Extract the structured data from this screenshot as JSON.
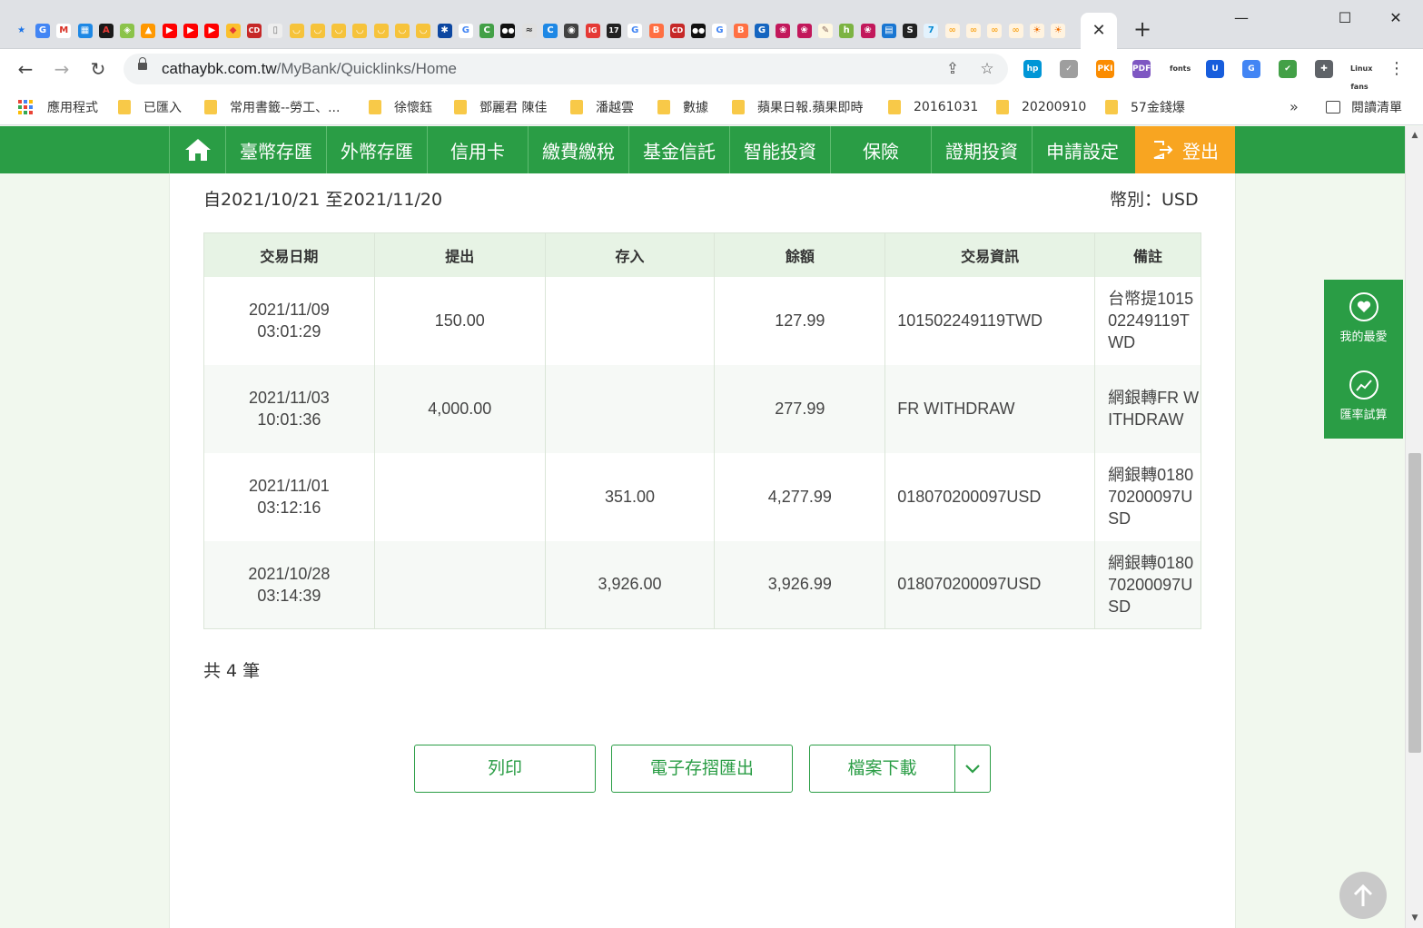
{
  "browser": {
    "favicons": [
      {
        "name": "bookmark-star-icon",
        "glyph": "★",
        "bg": "transparent",
        "fg": "#1a73e8"
      },
      {
        "name": "translate-icon",
        "glyph": "G",
        "bg": "#4285f4",
        "fg": "#fff"
      },
      {
        "name": "gmail-icon",
        "glyph": "M",
        "bg": "#fff",
        "fg": "#d93025"
      },
      {
        "name": "grid-app-icon",
        "glyph": "▦",
        "bg": "#1e88e5",
        "fg": "#fff"
      },
      {
        "name": "adobe-icon",
        "glyph": "A",
        "bg": "#1a1a1a",
        "fg": "#e53935"
      },
      {
        "name": "green-app-icon",
        "glyph": "◈",
        "bg": "#8bc34a",
        "fg": "#fff"
      },
      {
        "name": "orange-app-icon",
        "glyph": "▲",
        "bg": "#ff9800",
        "fg": "#fff"
      },
      {
        "name": "youtube-icon",
        "glyph": "▶",
        "bg": "#ff0000",
        "fg": "#fff"
      },
      {
        "name": "youtube-icon",
        "glyph": "▶",
        "bg": "#ff0000",
        "fg": "#fff"
      },
      {
        "name": "youtube-icon",
        "glyph": "▶",
        "bg": "#ff0000",
        "fg": "#fff"
      },
      {
        "name": "colorful-app-icon",
        "glyph": "◆",
        "bg": "#fbc02d",
        "fg": "#e53935"
      },
      {
        "name": "cd-icon",
        "glyph": "CD",
        "bg": "#c62828",
        "fg": "#fff"
      },
      {
        "name": "document-icon",
        "glyph": "▯",
        "bg": "#eee",
        "fg": "#777"
      },
      {
        "name": "yellow-site-icon",
        "glyph": "◡",
        "bg": "#f6c33b",
        "fg": "#fff"
      },
      {
        "name": "yellow-site-icon",
        "glyph": "◡",
        "bg": "#f6c33b",
        "fg": "#fff"
      },
      {
        "name": "yellow-site-icon",
        "glyph": "◡",
        "bg": "#f6c33b",
        "fg": "#fff"
      },
      {
        "name": "yellow-site-icon",
        "glyph": "◡",
        "bg": "#f6c33b",
        "fg": "#fff"
      },
      {
        "name": "yellow-site-icon",
        "glyph": "◡",
        "bg": "#f6c33b",
        "fg": "#fff"
      },
      {
        "name": "yellow-site-icon",
        "glyph": "◡",
        "bg": "#f6c33b",
        "fg": "#fff"
      },
      {
        "name": "yellow-site-icon",
        "glyph": "◡",
        "bg": "#f6c33b",
        "fg": "#fff"
      },
      {
        "name": "star-badge-icon",
        "glyph": "✱",
        "bg": "#0d47a1",
        "fg": "#fff"
      },
      {
        "name": "google-icon",
        "glyph": "G",
        "bg": "#fff",
        "fg": "#4285f4"
      },
      {
        "name": "c-app-icon",
        "glyph": "C",
        "bg": "#43a047",
        "fg": "#fff"
      },
      {
        "name": "medium-icon",
        "glyph": "●●",
        "bg": "#111",
        "fg": "#fff"
      },
      {
        "name": "ame-icon",
        "glyph": "≈",
        "bg": "#e0e0e0",
        "fg": "#333"
      },
      {
        "name": "c-app-icon",
        "glyph": "C",
        "bg": "#1e88e5",
        "fg": "#fff"
      },
      {
        "name": "globe-icon",
        "glyph": "◉",
        "bg": "#424242",
        "fg": "#fff"
      },
      {
        "name": "ig-icon",
        "glyph": "IG",
        "bg": "#e53935",
        "fg": "#fff"
      },
      {
        "name": "seventeen-icon",
        "glyph": "17",
        "bg": "#212121",
        "fg": "#fff"
      },
      {
        "name": "google-icon",
        "glyph": "G",
        "bg": "#fff",
        "fg": "#4285f4"
      },
      {
        "name": "blogger-icon",
        "glyph": "B",
        "bg": "#ff7043",
        "fg": "#fff"
      },
      {
        "name": "cd-icon",
        "glyph": "CD",
        "bg": "#c62828",
        "fg": "#fff"
      },
      {
        "name": "medium-icon",
        "glyph": "●●",
        "bg": "#111",
        "fg": "#fff"
      },
      {
        "name": "google-icon",
        "glyph": "G",
        "bg": "#fff",
        "fg": "#4285f4"
      },
      {
        "name": "blogger-icon",
        "glyph": "B",
        "bg": "#ff7043",
        "fg": "#fff"
      },
      {
        "name": "g-suite-icon",
        "glyph": "G",
        "bg": "#1565c0",
        "fg": "#fff"
      },
      {
        "name": "raspberry-icon",
        "glyph": "❀",
        "bg": "#c2185b",
        "fg": "#fff"
      },
      {
        "name": "raspberry-icon",
        "glyph": "❀",
        "bg": "#c2185b",
        "fg": "#fff"
      },
      {
        "name": "note-icon",
        "glyph": "✎",
        "bg": "#fff8e1",
        "fg": "#8d6e63"
      },
      {
        "name": "h-app-icon",
        "glyph": "h",
        "bg": "#7cb342",
        "fg": "#fff"
      },
      {
        "name": "raspberry-icon",
        "glyph": "❀",
        "bg": "#c2185b",
        "fg": "#fff"
      },
      {
        "name": "window-icon",
        "glyph": "▤",
        "bg": "#1976d2",
        "fg": "#fff"
      },
      {
        "name": "s-app-icon",
        "glyph": "S",
        "bg": "#222",
        "fg": "#fff"
      },
      {
        "name": "seven-icon",
        "glyph": "7",
        "bg": "#e3f2fd",
        "fg": "#0288d1"
      },
      {
        "name": "loop-icon",
        "glyph": "∞",
        "bg": "#fff3e0",
        "fg": "#f9a825"
      },
      {
        "name": "loop-icon",
        "glyph": "∞",
        "bg": "#fff3e0",
        "fg": "#f9a825"
      },
      {
        "name": "loop-icon",
        "glyph": "∞",
        "bg": "#fff3e0",
        "fg": "#f9a825"
      },
      {
        "name": "loop-icon",
        "glyph": "∞",
        "bg": "#fff3e0",
        "fg": "#f9a825"
      },
      {
        "name": "sun-site-icon",
        "glyph": "☀",
        "bg": "#fff3e0",
        "fg": "#ef6c00"
      },
      {
        "name": "sun-site-icon",
        "glyph": "☀",
        "bg": "#fff3e0",
        "fg": "#ef6c00"
      }
    ],
    "tab_close": "✕",
    "new_tab": "+",
    "window": {
      "minimize": "—",
      "maximize": "☐",
      "close": "✕"
    },
    "nav": {
      "back": "←",
      "forward": "→",
      "reload": "↻"
    },
    "address": {
      "host": "cathaybk.com.tw",
      "path": "/MyBank/Quicklinks/Home"
    },
    "extensions": [
      {
        "name": "hp-extension-icon",
        "glyph": "hp",
        "bg": "#0096d6"
      },
      {
        "name": "check-extension-icon",
        "glyph": "✓",
        "bg": "#9e9e9e"
      },
      {
        "name": "smart-pki-extension-icon",
        "glyph": "PKI",
        "bg": "#fb8c00"
      },
      {
        "name": "pdf-extension-icon",
        "glyph": "PDF",
        "bg": "#7e57c2"
      },
      {
        "name": "fonts-extension-icon",
        "glyph": "fonts",
        "bg": "#ffffff"
      },
      {
        "name": "bitwarden-icon",
        "glyph": "U",
        "bg": "#175ddc"
      },
      {
        "name": "translate-extension-icon",
        "glyph": "G",
        "bg": "#4285f4"
      },
      {
        "name": "shield-extension-icon",
        "glyph": "✔",
        "bg": "#43a047"
      },
      {
        "name": "puzzle-extension-icon",
        "glyph": "✚",
        "bg": "#5f6368"
      },
      {
        "name": "linux-fans-extension-icon",
        "glyph": "Linux fans",
        "bg": "#ffffff"
      }
    ],
    "bookmarks": {
      "apps": "應用程式",
      "items": [
        "已匯入",
        "常用書籤--勞工、...",
        "徐懷鈺",
        "鄧麗君 陳佳",
        "潘越雲",
        "數據",
        "蘋果日報.蘋果即時",
        "20161031",
        "20200910",
        "57金錢爆"
      ],
      "more": "»",
      "reading_list": "閱讀清單"
    }
  },
  "site": {
    "brand_green": "#2a9d45",
    "accent_orange": "#f8a521",
    "nav": [
      "臺幣存匯",
      "外幣存匯",
      "信用卡",
      "繳費繳稅",
      "基金信託",
      "智能投資",
      "保險",
      "證期投資",
      "申請設定"
    ],
    "logout": "登出",
    "period": "自2021/10/21 至2021/11/20",
    "currency": "幣別：USD",
    "table": {
      "headers": [
        "交易日期",
        "提出",
        "存入",
        "餘額",
        "交易資訊",
        "備註"
      ],
      "rows": [
        {
          "date": "2021/11/09",
          "time": "03:01:29",
          "withdraw": "150.00",
          "deposit": "",
          "balance": "127.99",
          "info": "101502249119TWD",
          "note": "台幣提101502249119TWD"
        },
        {
          "date": "2021/11/03",
          "time": "10:01:36",
          "withdraw": "4,000.00",
          "deposit": "",
          "balance": "277.99",
          "info": "FR WITHDRAW",
          "note": "網銀轉FR WITHDRAW"
        },
        {
          "date": "2021/11/01",
          "time": "03:12:16",
          "withdraw": "",
          "deposit": "351.00",
          "balance": "4,277.99",
          "info": "018070200097USD",
          "note": "網銀轉018070200097USD"
        },
        {
          "date": "2021/10/28",
          "time": "03:14:39",
          "withdraw": "",
          "deposit": "3,926.00",
          "balance": "3,926.99",
          "info": "018070200097USD",
          "note": "網銀轉018070200097USD"
        }
      ]
    },
    "total": "共 4 筆",
    "buttons": {
      "print": "列印",
      "export": "電子存摺匯出",
      "download": "檔案下載"
    },
    "float": {
      "favorites": "我的最愛",
      "fx_calc": "匯率試算"
    }
  }
}
